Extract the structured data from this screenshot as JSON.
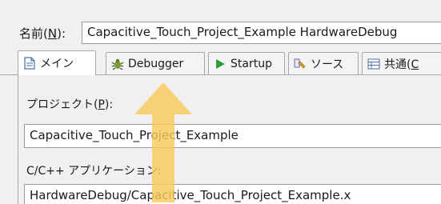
{
  "name_row": {
    "label_prefix": "名前(",
    "label_mnemonic": "N",
    "label_suffix": "):",
    "value": "Capacitive_Touch_Project_Example HardwareDebug"
  },
  "tabs": [
    {
      "label": "メイン",
      "icon": "document-icon"
    },
    {
      "label": "Debugger",
      "icon": "bug-icon"
    },
    {
      "label": "Startup",
      "icon": "play-icon"
    },
    {
      "label": "ソース",
      "icon": "source-icon"
    },
    {
      "label": "共通(",
      "mnemonic": "C",
      "icon": "common-icon"
    }
  ],
  "project": {
    "label_prefix": "プロジェクト(",
    "label_mnemonic": "P",
    "label_suffix": "):",
    "value": "Capacitive_Touch_Project_Example"
  },
  "application": {
    "label": "C/C++ アプリケーション:",
    "value": "HardwareDebug/Capacitive_Touch_Project_Example.x"
  },
  "colors": {
    "arrow": "#f9c95a",
    "play": "#2e9d3a",
    "window": "#f0f0f0"
  }
}
